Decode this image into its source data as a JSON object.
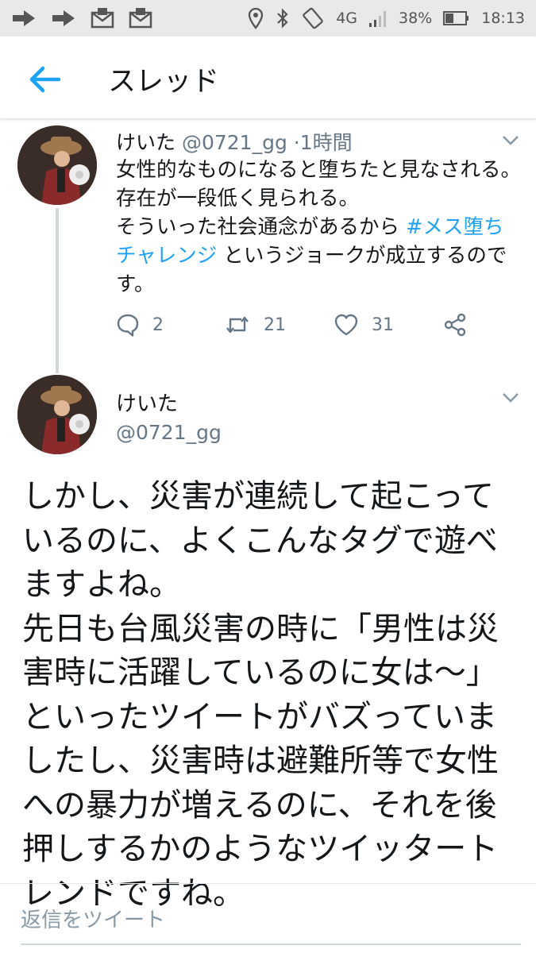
{
  "status_bar": {
    "network": "4G",
    "battery": "38%",
    "time": "18:13",
    "left_icons": [
      "forward-arrow-icon",
      "forward-arrow-icon",
      "mail-icon",
      "mail-icon"
    ],
    "right_icons": [
      "location-icon",
      "bluetooth-icon",
      "screen-rotate-icon",
      "signal-icon",
      "battery-icon"
    ]
  },
  "appbar": {
    "title": "スレッド"
  },
  "tweet1": {
    "name": "けいた",
    "handle": "@0721_gg",
    "separator": "·",
    "time": "1時間",
    "text_before": "女性的なものになると堕ちたと見なされる。存在が一段低く見られる。\nそういった社会通念があるから ",
    "hashtag": "#メス堕ちチャレンジ",
    "text_after": " というジョークが成立するのです。",
    "replies": "2",
    "retweets": "21",
    "likes": "31"
  },
  "tweet2": {
    "name": "けいた",
    "handle": "@0721_gg",
    "text": "しかし、災害が連続して起こっているのに、よくこんなタグで遊べますよね。\n先日も台風災害の時に「男性は災害時に活躍しているのに女は～」といったツイートがバズっていましたし、災害時は避難所等で女性への暴力が増えるのに、それを後押しするかのようなツイッタートレンドですね。"
  },
  "reply": {
    "placeholder": "返信をツイート"
  },
  "colors": {
    "accent": "#1da1f2",
    "secondary_text": "#657786",
    "primary_text": "#14171a"
  }
}
